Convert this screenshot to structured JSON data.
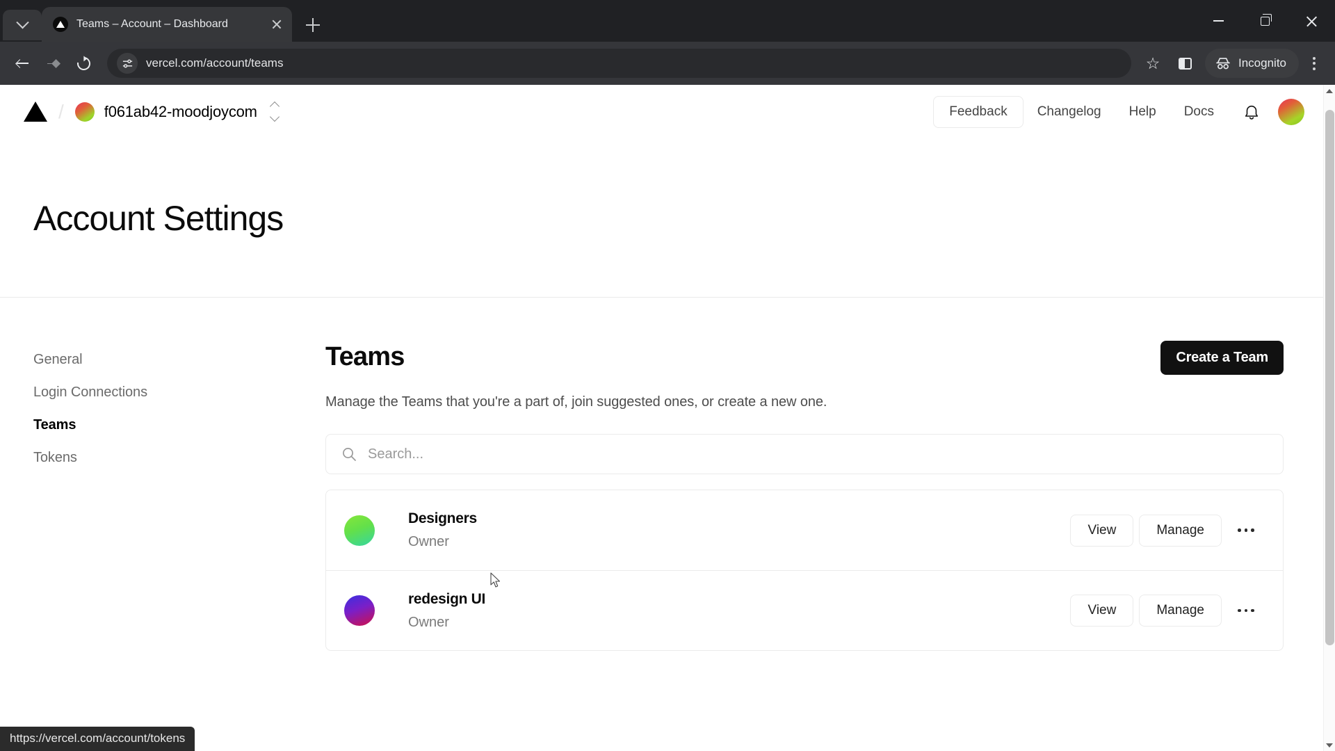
{
  "browser": {
    "tab": {
      "title": "Teams – Account – Dashboard",
      "favicon": "vercel-triangle-icon"
    },
    "tab_search_label": "Search tabs",
    "new_tab_label": "New Tab",
    "close_tab_label": "Close",
    "nav": {
      "back": "Back",
      "forward": "Forward",
      "reload": "Reload"
    },
    "omnibox": {
      "url": "vercel.com/account/teams",
      "site_info": "site-settings-icon"
    },
    "actions": {
      "bookmark": "Bookmark this tab",
      "side_panel": "Side panel",
      "incognito": "Incognito",
      "menu": "Customize and control Chrome"
    },
    "window": {
      "minimize": "Minimize",
      "maximize": "Maximize",
      "close": "Close"
    },
    "status_url": "https://vercel.com/account/tokens"
  },
  "app_header": {
    "logo": "vercel-logo-icon",
    "breadcrumb_separator": "/",
    "team": {
      "name": "f061ab42-moodjoycom",
      "avatar": "team-avatar"
    },
    "switcher_icon": "chevron-up-down-icon",
    "feedback_label": "Feedback",
    "links": [
      "Changelog",
      "Help",
      "Docs"
    ],
    "notifications_icon": "bell-icon",
    "user_avatar": "user-avatar"
  },
  "page_title": "Account Settings",
  "sidebar": {
    "items": [
      {
        "label": "General",
        "active": false
      },
      {
        "label": "Login Connections",
        "active": false
      },
      {
        "label": "Teams",
        "active": true
      },
      {
        "label": "Tokens",
        "active": false
      }
    ]
  },
  "teams_section": {
    "heading": "Teams",
    "create_button": "Create a Team",
    "description": "Manage the Teams that you're a part of, join suggested ones, or create a new one.",
    "search": {
      "placeholder": "Search...",
      "value": "",
      "icon": "search-icon"
    },
    "rows": [
      {
        "name": "Designers",
        "role": "Owner",
        "avatar": "designers-avatar",
        "view_label": "View",
        "manage_label": "Manage",
        "more_label": "More options"
      },
      {
        "name": "redesign UI",
        "role": "Owner",
        "avatar": "redesign-ui-avatar",
        "view_label": "View",
        "manage_label": "Manage",
        "more_label": "More options"
      }
    ]
  },
  "colors": {
    "primary_button_bg": "#111111",
    "chrome_dark": "#35363a",
    "tabstrip": "#202124",
    "border": "#ebebeb",
    "muted_text": "#7a7a7a"
  }
}
